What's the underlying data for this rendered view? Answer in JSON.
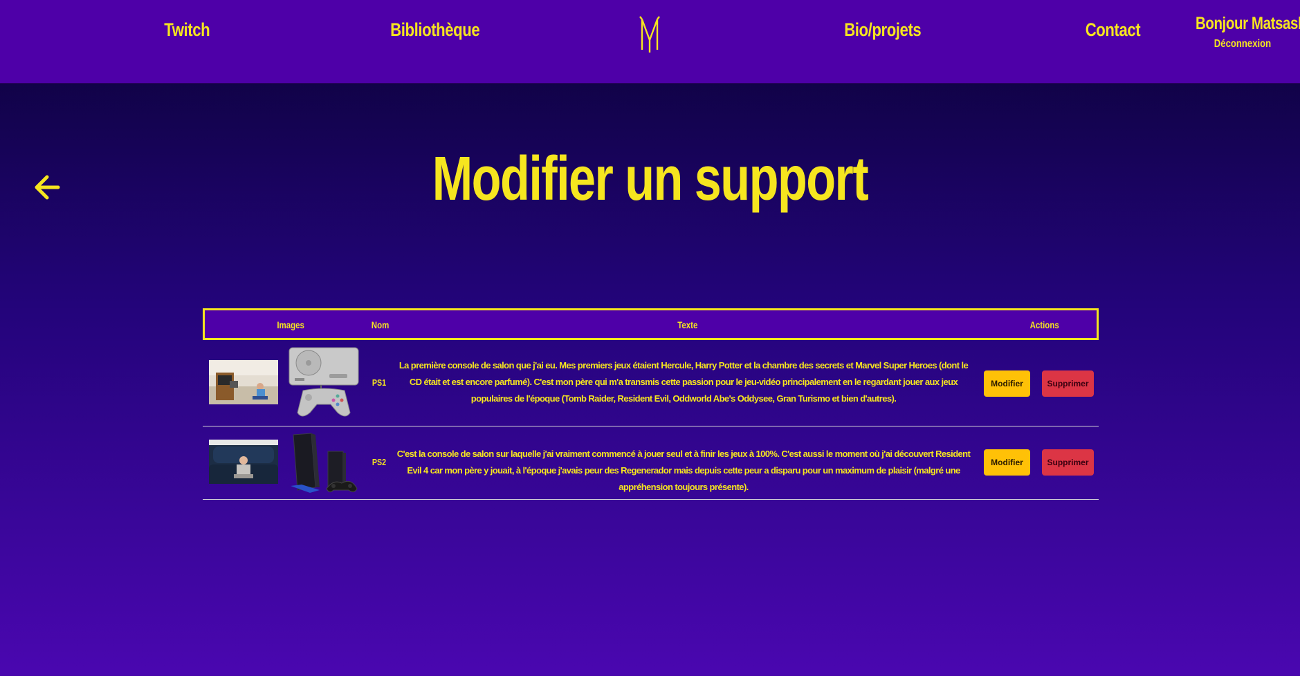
{
  "nav": {
    "twitch": "Twitch",
    "library": "Bibliothèque",
    "bio": "Bio/projets",
    "contact": "Contact",
    "greeting": "Bonjour Matsashi",
    "logout": "Déconnexion",
    "logo_alt": "M"
  },
  "page": {
    "title": "Modifier un support"
  },
  "table": {
    "headers": {
      "images": "Images",
      "name": "Nom",
      "text": "Texte",
      "actions": "Actions"
    },
    "rows": [
      {
        "name": "PS1",
        "text": "La première console de salon que j'ai eu. Mes premiers jeux étaient Hercule, Harry Potter et la chambre des secrets et Marvel Super Heroes (dont le CD était et est encore parfumé). C'est mon père qui m'a transmis cette passion pour le jeu-vidéo principalement en le regardant jouer aux jeux populaires de l'époque (Tomb Raider, Resident Evil, Oddworld Abe's Oddysee, Gran Turismo et bien d'autres).",
        "edit_label": "Modifier",
        "delete_label": "Supprimer"
      },
      {
        "name": "PS2",
        "text": "C'est la console de salon sur laquelle j'ai vraiment commencé à jouer seul et à finir les jeux à 100%. C'est aussi le moment où j'ai découvert Resident Evil 4 car mon père y jouait, à l'époque j'avais peur des Regenerador mais depuis cette peur a disparu pour un maximum de plaisir (malgré une appréhension toujours présente).",
        "edit_label": "Modifier",
        "delete_label": "Supprimer"
      }
    ]
  },
  "colors": {
    "accent": "#f6e51f",
    "navbar": "#4e00a8",
    "edit_button": "#ffc107",
    "delete_button": "#dc3545"
  },
  "icons": {
    "back": "arrow-left-icon",
    "logo": "m-logo-icon"
  }
}
